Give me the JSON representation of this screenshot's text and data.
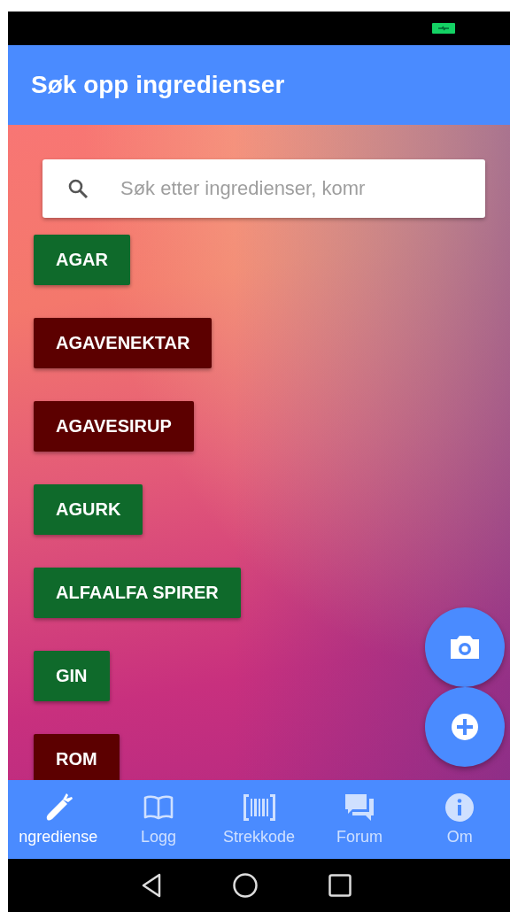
{
  "app_bar": {
    "title": "Søk opp ingredienser"
  },
  "search": {
    "placeholder": "Søk etter ingredienser, komr"
  },
  "ingredients": [
    {
      "label": "AGAR",
      "color": "#0f6a2b"
    },
    {
      "label": "AGAVENEKTAR",
      "color": "#5c0000"
    },
    {
      "label": "AGAVESIRUP",
      "color": "#5c0000"
    },
    {
      "label": "AGURK",
      "color": "#0f6a2b"
    },
    {
      "label": "ALFAALFA SPIRER",
      "color": "#0f6a2b"
    },
    {
      "label": "GIN",
      "color": "#0f6a2b"
    },
    {
      "label": "ROM",
      "color": "#5c0000"
    }
  ],
  "fabs": [
    {
      "kind": "camera"
    },
    {
      "kind": "add"
    }
  ],
  "nav": [
    {
      "label": "ngrediense",
      "kind": "carrot",
      "selected": true
    },
    {
      "label": "Logg",
      "kind": "book",
      "selected": false
    },
    {
      "label": "Strekkode",
      "kind": "barcode",
      "selected": false
    },
    {
      "label": "Forum",
      "kind": "chat",
      "selected": false
    },
    {
      "label": "Om",
      "kind": "info",
      "selected": false
    }
  ]
}
